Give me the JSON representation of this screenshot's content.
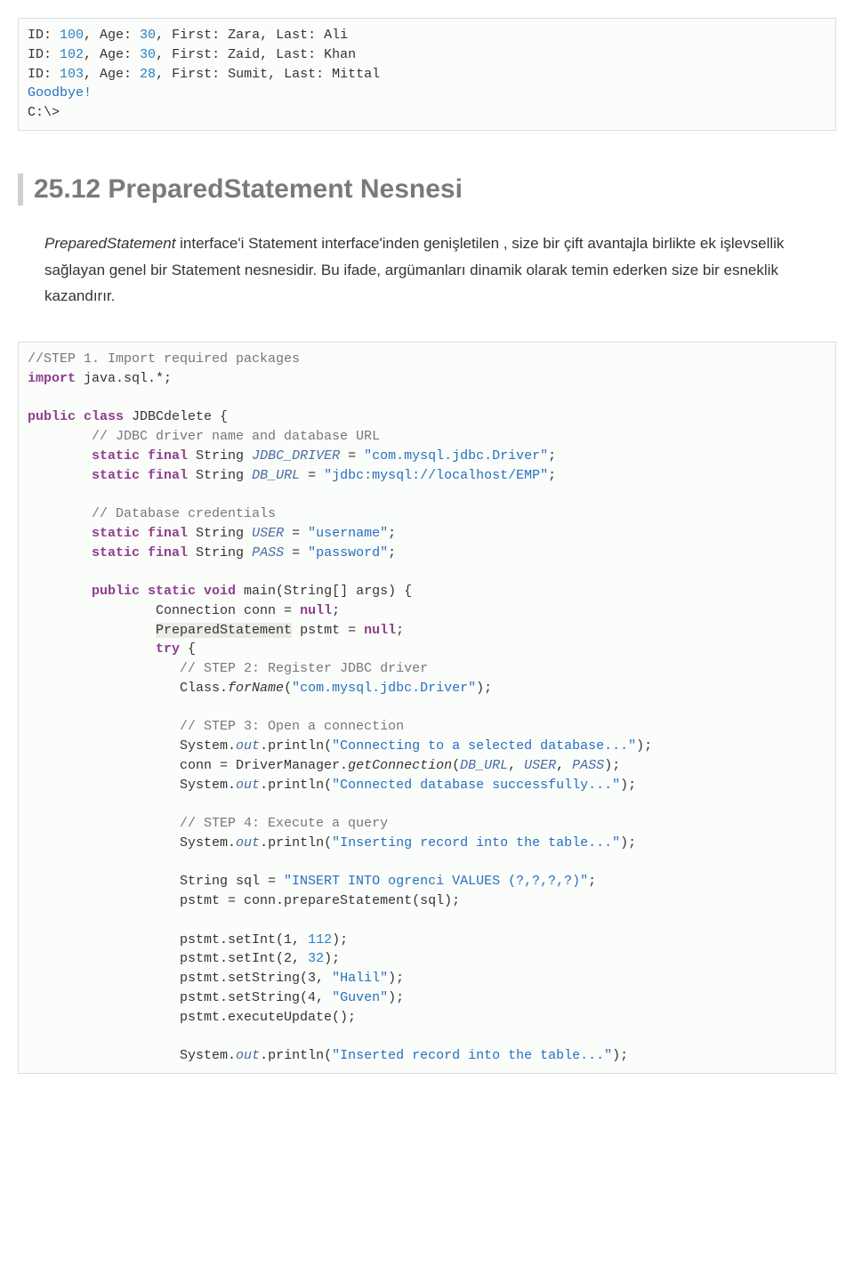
{
  "output_box": {
    "line1_pre": "ID: ",
    "line1_id": "100",
    "line1_mid1": ", Age: ",
    "line1_age": "30",
    "line1_mid2": ", First: Zara, Last: Ali",
    "line2_pre": "ID: ",
    "line2_id": "102",
    "line2_mid1": ", Age: ",
    "line2_age": "30",
    "line2_mid2": ", First: Zaid, Last: Khan",
    "line3_pre": "ID: ",
    "line3_id": "103",
    "line3_mid1": ", Age: ",
    "line3_age": "28",
    "line3_mid2": ", First: Sumit, Last: Mittal",
    "goodbye": "Goodbye!",
    "prompt": "C:\\>"
  },
  "heading": "25.12 PreparedStatement Nesnesi",
  "para": {
    "em": "PreparedStatement",
    "rest": " interface'i Statement interface'inden genişletilen , size bir çift avantajla birlikte ek işlevsellik sağlayan genel bir Statement nesnesidir. Bu ifade, argümanları dinamik olarak temin ederken size bir esneklik kazandırır."
  },
  "code": {
    "l01": "//STEP 1. Import required packages",
    "l02a": "import",
    "l02b": " java.sql.*;",
    "l03": "",
    "l04a": "public class",
    "l04b": " JDBCdelete {",
    "l05": "        // JDBC driver name and database URL",
    "l06a": "        ",
    "l06b": "static final",
    "l06c": " String ",
    "l06d": "JDBC_DRIVER",
    "l06e": " = ",
    "l06f": "\"com.mysql.jdbc.Driver\"",
    "l06g": ";",
    "l07a": "        ",
    "l07b": "static final",
    "l07c": " String ",
    "l07d": "DB_URL",
    "l07e": " = ",
    "l07f": "\"jdbc:mysql://localhost/EMP\"",
    "l07g": ";",
    "l08": "",
    "l09": "        // Database credentials",
    "l10a": "        ",
    "l10b": "static final",
    "l10c": " String ",
    "l10d": "USER",
    "l10e": " = ",
    "l10f": "\"username\"",
    "l10g": ";",
    "l11a": "        ",
    "l11b": "static final",
    "l11c": " String ",
    "l11d": "PASS",
    "l11e": " = ",
    "l11f": "\"password\"",
    "l11g": ";",
    "l12": "",
    "l13a": "        ",
    "l13b": "public static void",
    "l13c": " main(String[] args) {",
    "l14a": "                Connection conn = ",
    "l14b": "null",
    "l14c": ";",
    "l15a": "                ",
    "l15hl": "PreparedStatement",
    "l15b": " pstmt = ",
    "l15c": "null",
    "l15d": ";",
    "l16a": "                ",
    "l16b": "try",
    "l16c": " {",
    "l17": "                   // STEP 2: Register JDBC driver",
    "l18a": "                   Class.",
    "l18b": "forName",
    "l18c": "(",
    "l18d": "\"com.mysql.jdbc.Driver\"",
    "l18e": ");",
    "l19": "",
    "l20": "                   // STEP 3: Open a connection",
    "l21a": "                   System.",
    "l21b": "out",
    "l21c": ".println(",
    "l21d": "\"Connecting to a selected database...\"",
    "l21e": ");",
    "l22a": "                   conn = DriverManager.",
    "l22b": "getConnection",
    "l22c": "(",
    "l22d": "DB_URL",
    "l22e": ", ",
    "l22f": "USER",
    "l22g": ", ",
    "l22h": "PASS",
    "l22i": ");",
    "l23a": "                   System.",
    "l23b": "out",
    "l23c": ".println(",
    "l23d": "\"Connected database successfully...\"",
    "l23e": ");",
    "l24": "",
    "l25": "                   // STEP 4: Execute a query",
    "l26a": "                   System.",
    "l26b": "out",
    "l26c": ".println(",
    "l26d": "\"Inserting record into the table...\"",
    "l26e": ");",
    "l27": "",
    "l28a": "                   String sql = ",
    "l28b": "\"INSERT INTO ogrenci VALUES (?,?,?,?)\"",
    "l28c": ";",
    "l29": "                   pstmt = conn.prepareStatement(sql);",
    "l30": "",
    "l31a": "                   pstmt.setInt(1, ",
    "l31b": "112",
    "l31c": ");",
    "l32a": "                   pstmt.setInt(2, ",
    "l32b": "32",
    "l32c": ");",
    "l33a": "                   pstmt.setString(3, ",
    "l33b": "\"Halil\"",
    "l33c": ");",
    "l34a": "                   pstmt.setString(4, ",
    "l34b": "\"Guven\"",
    "l34c": ");",
    "l35": "                   pstmt.executeUpdate();",
    "l36": "",
    "l37a": "                   System.",
    "l37b": "out",
    "l37c": ".println(",
    "l37d": "\"Inserted record into the table...\"",
    "l37e": ");"
  }
}
